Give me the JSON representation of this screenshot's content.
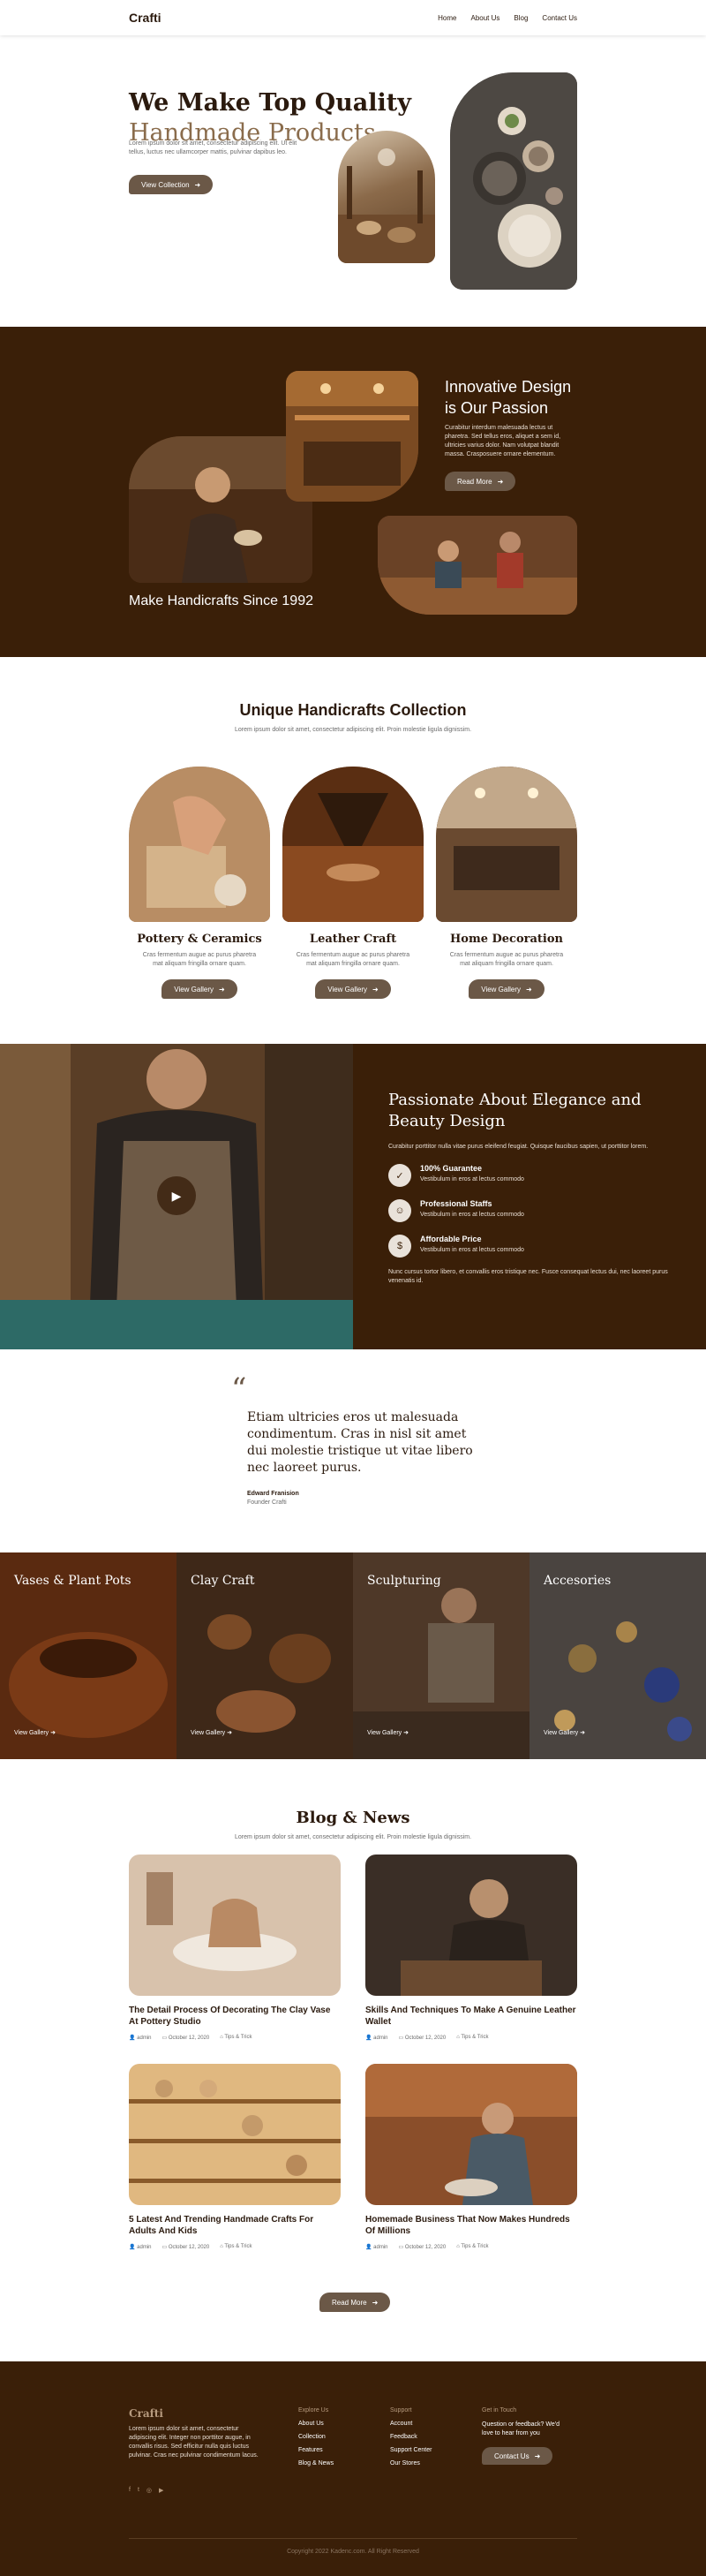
{
  "header": {
    "logo": "Crafti",
    "nav": [
      "Home",
      "About Us",
      "Blog",
      "Contact Us"
    ]
  },
  "hero": {
    "title_line1": "We Make Top Quality",
    "title_line2": "Handmade Products",
    "description": "Lorem ipsum dolor sit amet, consectetur adipiscing elit. Ut elit tellus, luctus nec ullamcorper mattis, pulvinar dapibus leo.",
    "button": "View Collection"
  },
  "innovative": {
    "title_line1": "Innovative Design",
    "title_line2": "is Our Passion",
    "description": "Curabitur interdum malesuada lectus ut pharetra. Sed tellus eros, aliquet a sem id, ultricies varius dolor. Nam volutpat blandit massa. Crasposuere ornare elementum.",
    "button": "Read More",
    "since": "Make Handicrafts Since 1992"
  },
  "collection": {
    "title": "Unique Handicrafts Collection",
    "subtitle": "Lorem ipsum dolor sit amet, consectetur adipiscing elit. Proin molestie ligula dignissim.",
    "cards": [
      {
        "title": "Pottery & Ceramics",
        "text": "Cras fermentum augue ac purus pharetra mat aliquam fringilla ornare quam.",
        "button": "View Gallery"
      },
      {
        "title": "Leather Craft",
        "text": "Cras fermentum augue ac purus pharetra mat aliquam fringilla ornare quam.",
        "button": "View Gallery"
      },
      {
        "title": "Home Decoration",
        "text": "Cras fermentum augue ac purus pharetra mat aliquam fringilla ornare quam.",
        "button": "View Gallery"
      }
    ]
  },
  "passion": {
    "title": "Passionate About Elegance and Beauty Design",
    "description": "Curabitur porttitor nulla vitae purus eleifend feugiat. Quisque faucibus sapien, ut porttitor lorem.",
    "features": [
      {
        "title": "100% Guarantee",
        "text": "Vestibulum in eros at lectus commodo"
      },
      {
        "title": "Professional Staffs",
        "text": "Vestibulum in eros at lectus commodo"
      },
      {
        "title": "Affordable Price",
        "text": "Vestibulum in eros at lectus commodo"
      }
    ],
    "footer_text": "Nunc cursus tortor libero, et convallis eros tristique nec. Fusce consequat lectus dui, nec laoreet purus venenatis id."
  },
  "testimonial": {
    "mark": "“",
    "quote": "Etiam ultricies eros ut malesuada condimentum. Cras in nisl sit amet dui molestie tristique ut vitae libero nec laoreet purus.",
    "author": "Edward Franision",
    "role": "Founder Crafti"
  },
  "gallery": [
    {
      "title": "Vases & Plant Pots",
      "link": "View Gallery"
    },
    {
      "title": "Clay Craft",
      "link": "View Gallery"
    },
    {
      "title": "Sculpturing",
      "link": "View Gallery"
    },
    {
      "title": "Accesories",
      "link": "View Gallery"
    }
  ],
  "blog": {
    "title": "Blog & News",
    "subtitle": "Lorem ipsum dolor sit amet, consectetur adipiscing elit. Proin molestie ligula dignissim.",
    "posts": [
      {
        "title": "The Detail Process Of Decorating The Clay Vase At Pottery Studio",
        "author": "admin",
        "date": "October 12, 2020",
        "category": "Tips & Trick"
      },
      {
        "title": "Skills And Techniques To Make A Genuine Leather Wallet",
        "author": "admin",
        "date": "October 12, 2020",
        "category": "Tips & Trick"
      },
      {
        "title": "5 Latest And Trending Handmade Crafts For Adults And Kids",
        "author": "admin",
        "date": "October 12, 2020",
        "category": "Tips & Trick"
      },
      {
        "title": "Homemade Business That Now Makes Hundreds Of Millions",
        "author": "admin",
        "date": "October 12, 2020",
        "category": "Tips & Trick"
      }
    ],
    "button": "Read More"
  },
  "footer": {
    "logo": "Crafti",
    "description": "Lorem ipsum dolor sit amet, consectetur adipiscing elit. Integer non porttitor augue, in convallis risus. Sed efficitur nulla quis luctus pulvinar. Cras nec pulvinar condimentum lacus.",
    "explore_title": "Explore Us",
    "explore": [
      "About Us",
      "Collection",
      "Features",
      "Blog & News"
    ],
    "support_title": "Support",
    "support": [
      "Account",
      "Feedback",
      "Support Center",
      "Our Stores"
    ],
    "touch_title": "Get in Touch",
    "touch_text": "Question or feedback? We'd love to hear from you",
    "touch_button": "Contact Us",
    "copyright": "Copyright 2022 Kadenc.com. All Right Reserved"
  },
  "colors": {
    "brown_dark": "#3a1f08",
    "accent": "#6b5847",
    "tan": "#8a6c4c"
  }
}
